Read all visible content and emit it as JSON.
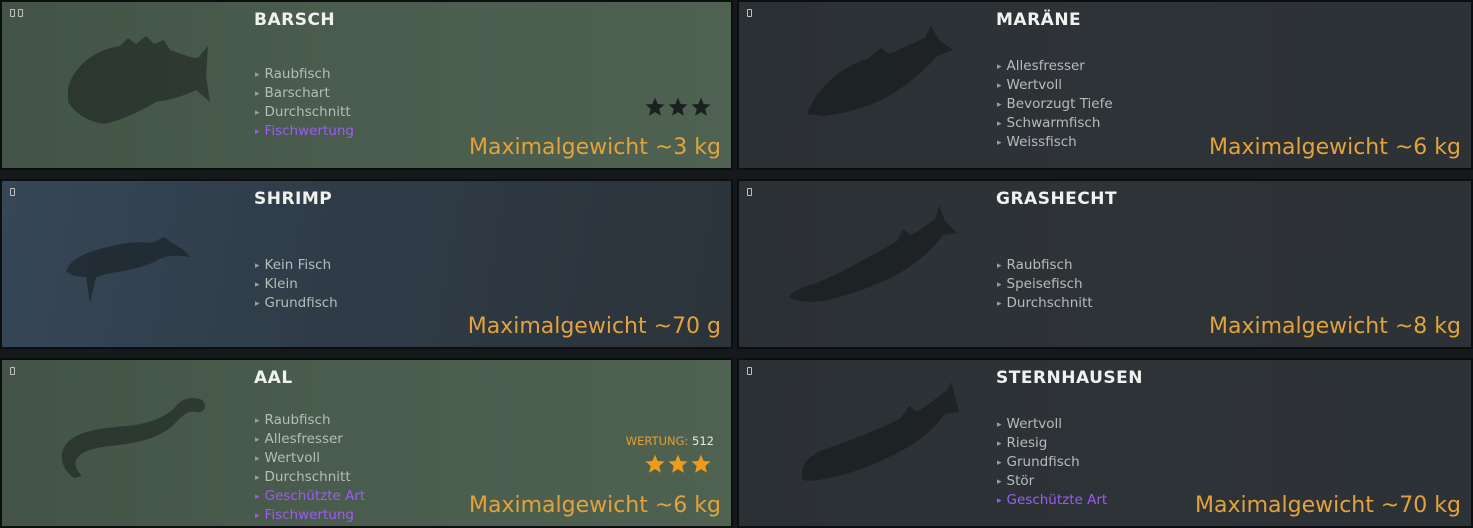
{
  "cards": [
    {
      "id": "barsch",
      "title": "BARSCH",
      "style": "green",
      "tags": [
        {
          "text": "Raubfisch",
          "special": false
        },
        {
          "text": "Barschart",
          "special": false
        },
        {
          "text": "Durchschnitt",
          "special": false
        },
        {
          "text": "Fischwertung",
          "special": true
        }
      ],
      "weight": "Maximalgewicht ~3 kg",
      "rating": {
        "filled": 0,
        "total": 3
      },
      "score": null,
      "badge_marks": 2,
      "fish_icon": "perch-silhouette-icon"
    },
    {
      "id": "maraene",
      "title": "MARÄNE",
      "style": "dark",
      "tags": [
        {
          "text": "Allesfresser",
          "special": false
        },
        {
          "text": "Wertvoll",
          "special": false
        },
        {
          "text": "Bevorzugt Tiefe",
          "special": false
        },
        {
          "text": "Schwarmfisch",
          "special": false
        },
        {
          "text": "Weissfisch",
          "special": false
        }
      ],
      "weight": "Maximalgewicht ~6 kg",
      "rating": null,
      "score": null,
      "badge_marks": 1,
      "fish_icon": "whitefish-silhouette-icon"
    },
    {
      "id": "shrimp",
      "title": "SHRIMP",
      "style": "blue",
      "tags": [
        {
          "text": "Kein Fisch",
          "special": false
        },
        {
          "text": "Klein",
          "special": false
        },
        {
          "text": "Grundfisch",
          "special": false
        }
      ],
      "weight": "Maximalgewicht ~70 g",
      "rating": null,
      "score": null,
      "badge_marks": 1,
      "fish_icon": "shrimp-silhouette-icon"
    },
    {
      "id": "grashecht",
      "title": "GRASHECHT",
      "style": "dark",
      "tags": [
        {
          "text": "Raubfisch",
          "special": false
        },
        {
          "text": "Speisefisch",
          "special": false
        },
        {
          "text": "Durchschnitt",
          "special": false
        }
      ],
      "weight": "Maximalgewicht ~8 kg",
      "rating": null,
      "score": null,
      "badge_marks": 1,
      "fish_icon": "pike-silhouette-icon"
    },
    {
      "id": "aal",
      "title": "AAL",
      "style": "green",
      "tags": [
        {
          "text": "Raubfisch",
          "special": false
        },
        {
          "text": "Allesfresser",
          "special": false
        },
        {
          "text": "Wertvoll",
          "special": false
        },
        {
          "text": "Durchschnitt",
          "special": false
        },
        {
          "text": "Geschützte Art",
          "special": true
        },
        {
          "text": "Fischwertung",
          "special": true
        }
      ],
      "weight": "Maximalgewicht ~6 kg",
      "rating": {
        "filled": 3,
        "total": 3
      },
      "score": {
        "label": "WERTUNG:",
        "value": "512"
      },
      "badge_marks": 1,
      "fish_icon": "eel-silhouette-icon"
    },
    {
      "id": "sternhausen",
      "title": "STERNHAUSEN",
      "style": "dark",
      "tags": [
        {
          "text": "Wertvoll",
          "special": false
        },
        {
          "text": "Riesig",
          "special": false
        },
        {
          "text": "Grundfisch",
          "special": false
        },
        {
          "text": "Stör",
          "special": false
        },
        {
          "text": "Geschützte Art",
          "special": true
        }
      ],
      "weight": "Maximalgewicht ~70 kg",
      "rating": null,
      "score": null,
      "badge_marks": 1,
      "fish_icon": "sturgeon-silhouette-icon"
    }
  ],
  "colors": {
    "weight": "#e3a23a",
    "special_tag": "#9c5cf2",
    "star_filled": "#f09a1a",
    "star_empty": "#1b2020"
  }
}
